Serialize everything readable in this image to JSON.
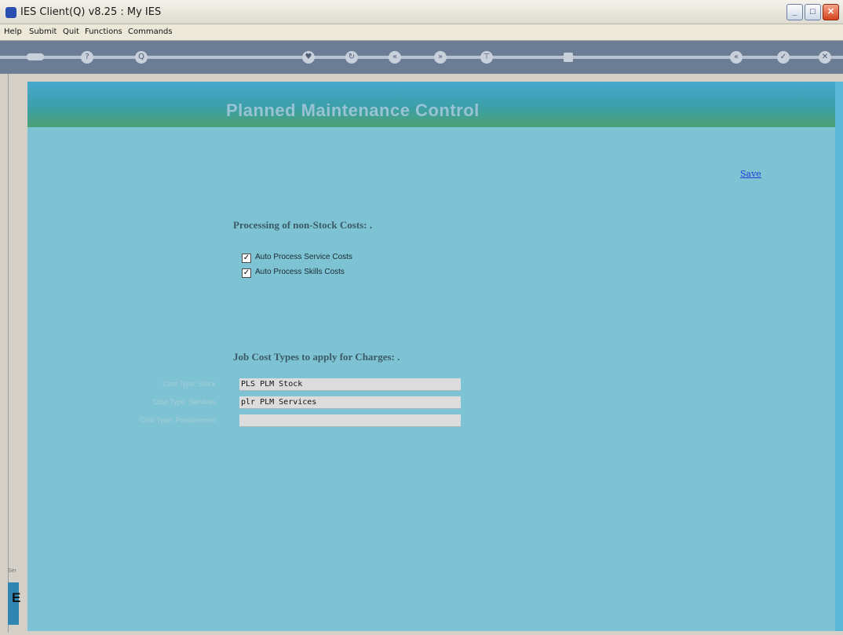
{
  "window": {
    "title": "IES Client(Q) v8.25 : My IES",
    "controls": {
      "minimize": "_",
      "maximize": "□",
      "close": "✕"
    }
  },
  "menu": [
    "Help",
    "Submit",
    "Quit",
    "Functions",
    "Commands"
  ],
  "toolbar": {
    "buttons": [
      {
        "name": "login-icon",
        "glyph": ""
      },
      {
        "name": "help-icon",
        "glyph": "?"
      },
      {
        "name": "search-icon",
        "glyph": "Q"
      },
      {
        "name": "favorite-icon",
        "glyph": "♥"
      },
      {
        "name": "refresh-icon",
        "glyph": "↻"
      },
      {
        "name": "previous-icon",
        "glyph": "«"
      },
      {
        "name": "next-icon",
        "glyph": "»"
      },
      {
        "name": "tree-icon",
        "glyph": "⊤"
      },
      {
        "name": "stop-icon",
        "glyph": ""
      },
      {
        "name": "back-icon",
        "glyph": "«"
      },
      {
        "name": "check-icon",
        "glyph": "✓"
      },
      {
        "name": "cancel-icon",
        "glyph": "✕"
      }
    ]
  },
  "page": {
    "header_title": "Planned Maintenance Control",
    "save_label": "Save",
    "non_stock_section": {
      "title": "Processing of non-Stock Costs: .",
      "options": [
        {
          "label": "Auto Process Service Costs",
          "checked": true
        },
        {
          "label": "Auto Process Skills Costs",
          "checked": true
        }
      ]
    },
    "job_cost_section": {
      "title": "Job Cost Types to apply for Charges: .",
      "fields": [
        {
          "label": "Cost Type: Stock",
          "value": "PLS PLM Stock"
        },
        {
          "label": "Cost Type: Services",
          "value": "plr PLM Services"
        },
        {
          "label": "Cost Type: Procurement",
          "value": ""
        }
      ]
    }
  },
  "left_edge": {
    "letter": "E",
    "tag": "Ser"
  },
  "colors": {
    "content_bg": "#7ec3d4",
    "header_gradient_top": "#47a8cf",
    "header_gradient_bottom": "#4aa173",
    "toolbar_bg": "#6b7c95",
    "link": "#1c3bd8"
  }
}
